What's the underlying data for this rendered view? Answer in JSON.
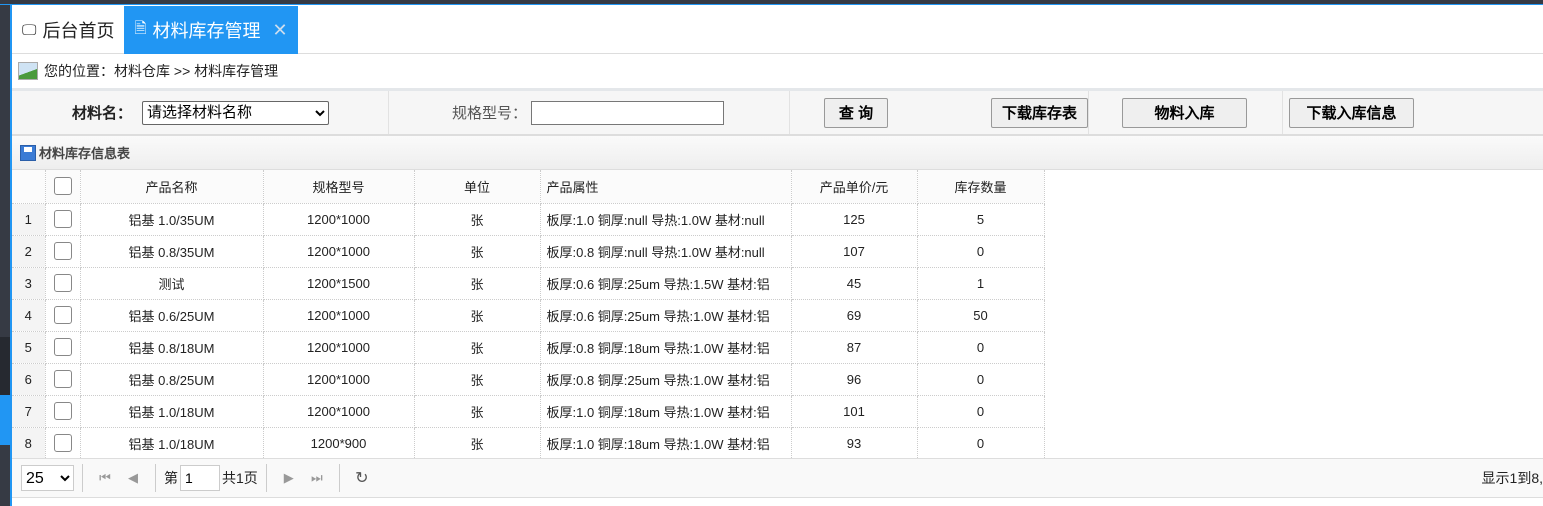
{
  "tabs": [
    {
      "label": "后台首页",
      "icon": "monitor-icon"
    },
    {
      "label": "材料库存管理",
      "icon": "document-icon",
      "active": true
    }
  ],
  "breadcrumb": "您的位置：材料仓库 >> 材料库存管理",
  "toolbar": {
    "material_label": "材料名：",
    "material_select": "请选择材料名称",
    "spec_label": "规格型号：",
    "spec_value": "",
    "query": "查 询",
    "download_stock": "下载库存表",
    "material_in": "物料入库",
    "download_in": "下载入库信息"
  },
  "table": {
    "title": "材料库存信息表",
    "columns": [
      "产品名称",
      "规格型号",
      "单位",
      "产品属性",
      "产品单价/元",
      "库存数量"
    ],
    "rows": [
      [
        "1",
        "铝基 1.0/35UM",
        "1200*1000",
        "张",
        "板厚:1.0 铜厚:null 导热:1.0W 基材:null",
        "125",
        "5"
      ],
      [
        "2",
        "铝基 0.8/35UM",
        "1200*1000",
        "张",
        "板厚:0.8 铜厚:null 导热:1.0W 基材:null",
        "107",
        "0"
      ],
      [
        "3",
        "测试",
        "1200*1500",
        "张",
        "板厚:0.6 铜厚:25um 导热:1.5W 基材:铝",
        "45",
        "1"
      ],
      [
        "4",
        "铝基 0.6/25UM",
        "1200*1000",
        "张",
        "板厚:0.6 铜厚:25um 导热:1.0W 基材:铝",
        "69",
        "50"
      ],
      [
        "5",
        "铝基 0.8/18UM",
        "1200*1000",
        "张",
        "板厚:0.8 铜厚:18um 导热:1.0W 基材:铝",
        "87",
        "0"
      ],
      [
        "6",
        "铝基 0.8/25UM",
        "1200*1000",
        "张",
        "板厚:0.8 铜厚:25um 导热:1.0W 基材:铝",
        "96",
        "0"
      ],
      [
        "7",
        "铝基 1.0/18UM",
        "1200*1000",
        "张",
        "板厚:1.0 铜厚:18um 导热:1.0W 基材:铝",
        "101",
        "0"
      ],
      [
        "8",
        "铝基 1.0/18UM",
        "1200*900",
        "张",
        "板厚:1.0 铜厚:18um 导热:1.0W 基材:铝",
        "93",
        "0"
      ]
    ]
  },
  "pager": {
    "page_size": "25",
    "page_prefix": "第",
    "page": "1",
    "total": "共1页",
    "info": "显示1到8,"
  },
  "colors": {
    "accent": "#2196f3",
    "sidebar": "#363a44"
  }
}
